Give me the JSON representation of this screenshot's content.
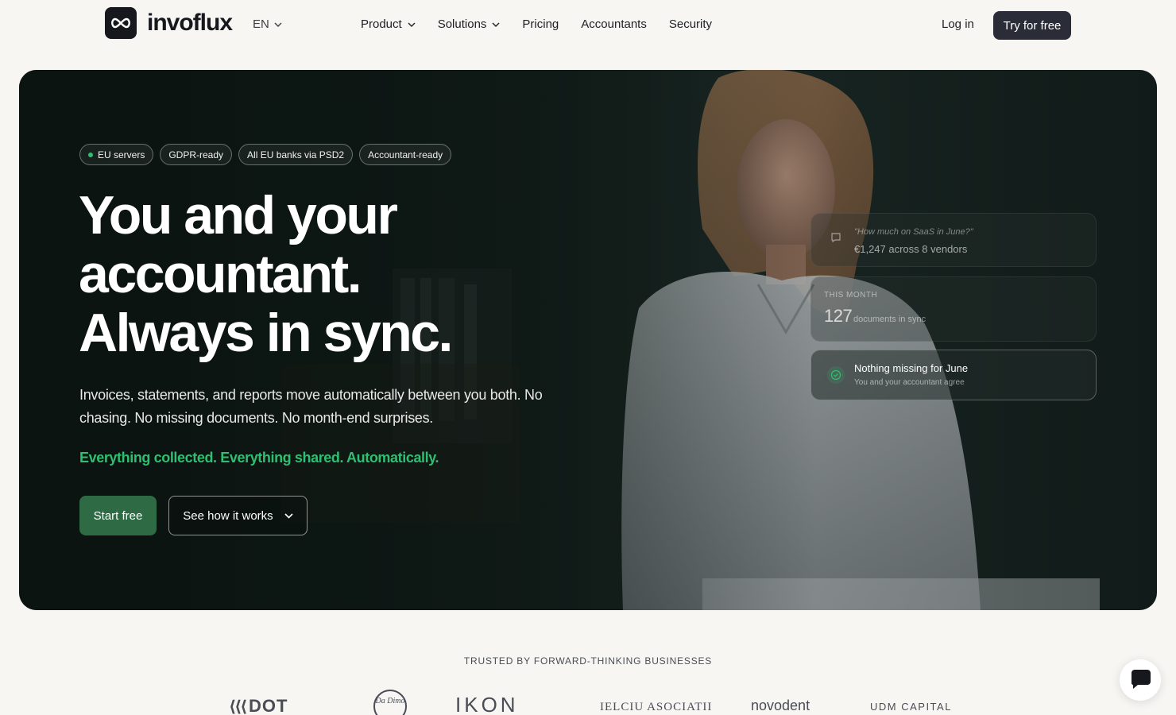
{
  "brand": {
    "name": "invoflux"
  },
  "nav": {
    "lang": "EN",
    "links": [
      {
        "label": "Product",
        "has_dropdown": true
      },
      {
        "label": "Solutions",
        "has_dropdown": true
      },
      {
        "label": "Pricing",
        "has_dropdown": false
      },
      {
        "label": "Accountants",
        "has_dropdown": false
      },
      {
        "label": "Security",
        "has_dropdown": false
      }
    ],
    "login": "Log in",
    "cta": "Try for free"
  },
  "hero": {
    "pills": [
      "EU servers",
      "GDPR-ready",
      "All EU banks via PSD2",
      "Accountant-ready"
    ],
    "headline": [
      "You and your",
      "accountant.",
      "Always in sync."
    ],
    "subtext": "Invoices, statements, and reports move automatically between you both. No chasing. No missing documents. No month-end surprises.",
    "accent_line": "Everything collected. Everything shared. Automatically.",
    "primary_button": "Start free",
    "secondary_button": "See how it works",
    "cards": {
      "question": "\"How much on SaaS in June?\"",
      "answer": "€1,247 across 8 vendors",
      "month_label": "THIS MONTH",
      "month_count": "127",
      "month_sub": "documents in sync",
      "status_title": "Nothing missing for June",
      "status_sub": "You and your accountant agree"
    }
  },
  "trusted": {
    "label": "TRUSTED BY FORWARD-THINKING BUSINESSES",
    "brands": [
      "DOT",
      "Da Dimo",
      "IKON",
      "IELCIU ASOCIATII",
      "novodent",
      "UDM CAPITAL"
    ]
  },
  "colors": {
    "accent_green": "#2fbf71",
    "primary_button": "#2e6b45",
    "nav_cta": "#2a2d38"
  }
}
